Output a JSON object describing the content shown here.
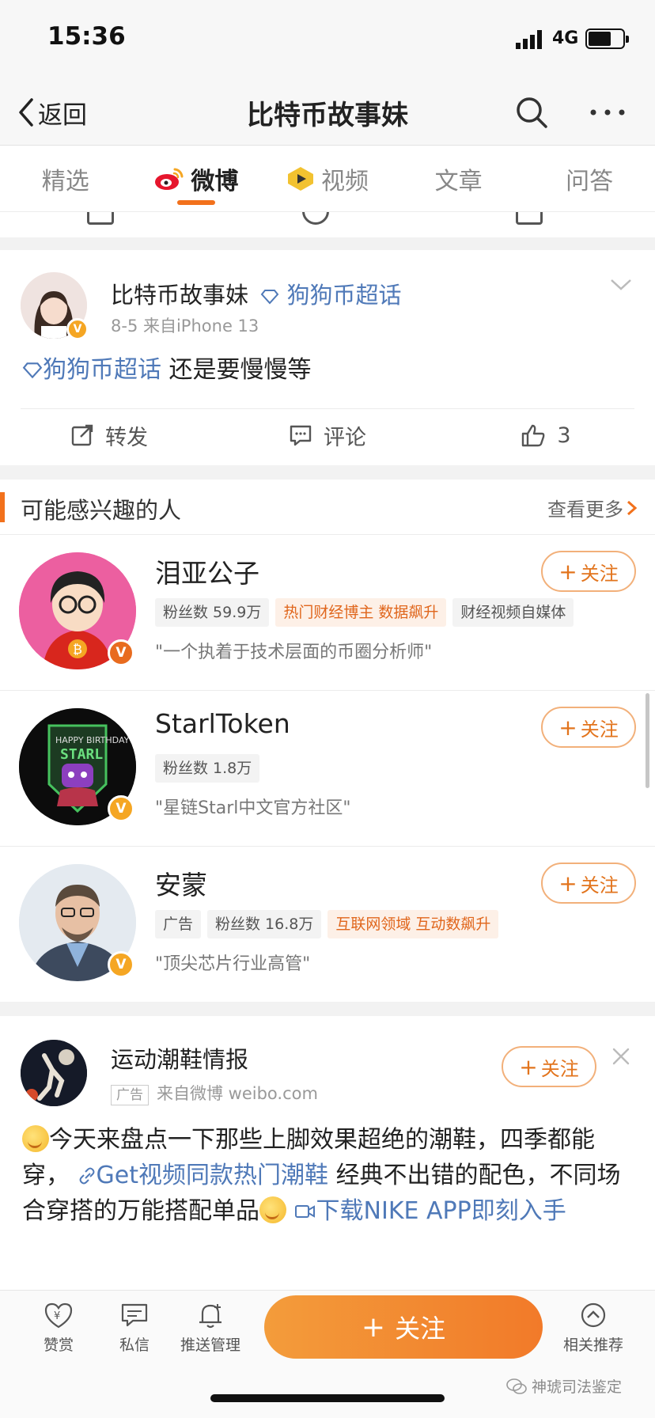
{
  "status_bar": {
    "time": "15:36",
    "network": "4G"
  },
  "nav": {
    "back_label": "返回",
    "title": "比特币故事妹"
  },
  "tabs": [
    {
      "label": "精选"
    },
    {
      "label": "微博"
    },
    {
      "label": "视频"
    },
    {
      "label": "文章"
    },
    {
      "label": "问答"
    }
  ],
  "post": {
    "author": "比特币故事妹",
    "topic": "狗狗币超话",
    "meta": "8-5  来自iPhone 13",
    "text_topic": "狗狗币超话",
    "text": "还是要慢慢等",
    "actions": {
      "repost": "转发",
      "comment": "评论",
      "like_count": "3"
    }
  },
  "recommend": {
    "title": "可能感兴趣的人",
    "more": "查看更多",
    "users": [
      {
        "name": "泪亚公子",
        "tags": [
          "粉丝数 59.9万",
          "热门财经博主 数据飙升",
          "财经视频自媒体"
        ],
        "desc": "\"一个执着于技术层面的币圈分析师\""
      },
      {
        "name": "StarlToken",
        "tags": [
          "粉丝数 1.8万"
        ],
        "desc": "\"星链Starl中文官方社区\""
      },
      {
        "name": "安蒙",
        "tags": [
          "广告",
          "粉丝数 16.8万",
          "互联网领域 互动数飙升"
        ],
        "desc": "\"顶尖芯片行业高管\""
      }
    ],
    "follow_label": "关注"
  },
  "ad_post": {
    "author": "运动潮鞋情报",
    "ad_tag": "广告",
    "meta": "来自微博 weibo.com",
    "follow_label": "关注",
    "text1": "今天来盘点一下那些上脚效果超绝的潮鞋，四季都能穿，",
    "link1": "Get视频同款热门潮鞋",
    "text2": "经典不出错的配色，不同场合穿搭的万能搭配单品",
    "link2": "下载NIKE APP即刻入手"
  },
  "bottom_bar": {
    "reward": "赞赏",
    "message": "私信",
    "push": "推送管理",
    "follow": "关注",
    "related": "相关推荐"
  },
  "watermark": "神琥司法鉴定",
  "colors": {
    "accent": "#f2711c",
    "link": "#4f79b8",
    "follow_border": "#f2b07a"
  },
  "icons": [
    "back-chevron-icon",
    "search-icon",
    "more-icon",
    "weibo-icon",
    "video-icon",
    "repost-icon",
    "comment-icon",
    "like-icon",
    "close-icon",
    "link-icon",
    "video-link-icon",
    "reward-icon",
    "message-icon",
    "bell-icon",
    "related-icon"
  ]
}
